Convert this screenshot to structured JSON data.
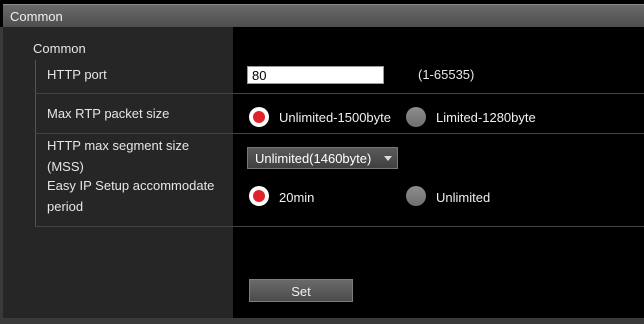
{
  "header": {
    "title": "Common"
  },
  "section": {
    "label": "Common"
  },
  "rows": {
    "http_port": {
      "label": "HTTP port",
      "value": "80",
      "hint": "(1-65535)"
    },
    "max_rtp": {
      "label": "Max RTP packet size",
      "options": [
        "Unlimited-1500byte",
        "Limited-1280byte"
      ],
      "selected": "Unlimited-1500byte"
    },
    "mss": {
      "label_line1": "HTTP max segment size",
      "label_line2": "(MSS)",
      "selected": "Unlimited(1460byte)"
    },
    "easy_ip": {
      "label_line1": "Easy IP Setup accommodate",
      "label_line2": "period",
      "options": [
        "20min",
        "Unlimited"
      ],
      "selected": "20min"
    }
  },
  "actions": {
    "set_label": "Set"
  },
  "colors": {
    "radio_selected": "#e0232b",
    "panel": "#262626",
    "background": "#000000"
  }
}
